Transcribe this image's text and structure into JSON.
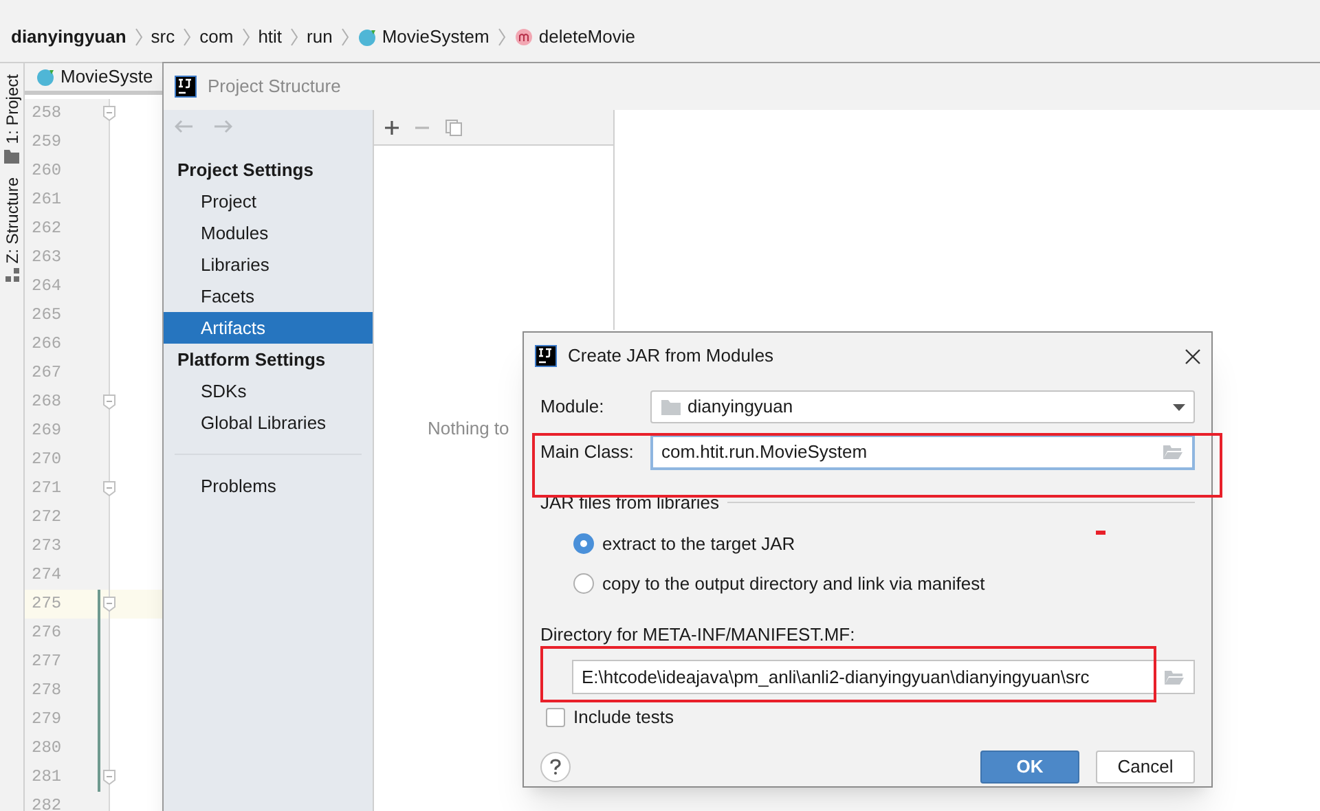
{
  "breadcrumbs": [
    {
      "label": "dianyingyuan",
      "kind": "project"
    },
    {
      "label": "src",
      "kind": "folder"
    },
    {
      "label": "com",
      "kind": "folder"
    },
    {
      "label": "htit",
      "kind": "folder"
    },
    {
      "label": "run",
      "kind": "folder"
    },
    {
      "label": "MovieSystem",
      "kind": "class"
    },
    {
      "label": "deleteMovie",
      "kind": "method"
    }
  ],
  "tool_strip": [
    {
      "label": "1: Project",
      "kind": "project"
    },
    {
      "label": "Z: Structure",
      "kind": "structure"
    }
  ],
  "editor": {
    "tab": "MovieSyste",
    "lines": [
      {
        "number": "258",
        "fold": true,
        "current": false,
        "changed": false
      },
      {
        "number": "259",
        "fold": false,
        "current": false,
        "changed": false
      },
      {
        "number": "260",
        "fold": false,
        "current": false,
        "changed": false
      },
      {
        "number": "261",
        "fold": false,
        "current": false,
        "changed": false
      },
      {
        "number": "262",
        "fold": false,
        "current": false,
        "changed": false
      },
      {
        "number": "263",
        "fold": false,
        "current": false,
        "changed": false
      },
      {
        "number": "264",
        "fold": false,
        "current": false,
        "changed": false
      },
      {
        "number": "265",
        "fold": false,
        "current": false,
        "changed": false
      },
      {
        "number": "266",
        "fold": false,
        "current": false,
        "changed": false
      },
      {
        "number": "267",
        "fold": false,
        "current": false,
        "changed": false
      },
      {
        "number": "268",
        "fold": true,
        "current": false,
        "changed": false
      },
      {
        "number": "269",
        "fold": false,
        "current": false,
        "changed": false
      },
      {
        "number": "270",
        "fold": false,
        "current": false,
        "changed": false
      },
      {
        "number": "271",
        "fold": true,
        "current": false,
        "changed": false
      },
      {
        "number": "272",
        "fold": false,
        "current": false,
        "changed": false
      },
      {
        "number": "273",
        "fold": false,
        "current": false,
        "changed": false
      },
      {
        "number": "274",
        "fold": false,
        "current": false,
        "changed": false
      },
      {
        "number": "275",
        "fold": true,
        "current": true,
        "changed": true
      },
      {
        "number": "276",
        "fold": false,
        "current": false,
        "changed": true
      },
      {
        "number": "277",
        "fold": false,
        "current": false,
        "changed": true
      },
      {
        "number": "278",
        "fold": false,
        "current": false,
        "changed": true
      },
      {
        "number": "279",
        "fold": false,
        "current": false,
        "changed": true
      },
      {
        "number": "280",
        "fold": false,
        "current": false,
        "changed": true
      },
      {
        "number": "281",
        "fold": true,
        "current": false,
        "changed": true
      },
      {
        "number": "282",
        "fold": false,
        "current": false,
        "changed": false
      }
    ]
  },
  "project_structure": {
    "title": "Project Structure",
    "sections": [
      {
        "title": "Project Settings",
        "items": [
          {
            "label": "Project",
            "selected": false
          },
          {
            "label": "Modules",
            "selected": false
          },
          {
            "label": "Libraries",
            "selected": false
          },
          {
            "label": "Facets",
            "selected": false
          },
          {
            "label": "Artifacts",
            "selected": true
          }
        ]
      },
      {
        "title": "Platform Settings",
        "items": [
          {
            "label": "SDKs",
            "selected": false
          },
          {
            "label": "Global Libraries",
            "selected": false
          }
        ]
      }
    ],
    "problems": {
      "label": "Problems",
      "selected": false
    },
    "empty_text": "Nothing to"
  },
  "jar_dialog": {
    "title": "Create JAR from Modules",
    "module_label": "Module:",
    "module_value": "dianyingyuan",
    "main_class_label": "Main Class:",
    "main_class_value": "com.htit.run.MovieSystem",
    "libraries_heading": "JAR files from libraries",
    "library_options": [
      {
        "label": "extract to the target JAR",
        "selected": true
      },
      {
        "label": "copy to the output directory and link via manifest",
        "selected": false
      }
    ],
    "manifest_label": "Directory for META-INF/MANIFEST.MF:",
    "manifest_value": "E:\\htcode\\ideajava\\pm_anli\\anli2-dianyingyuan\\dianyingyuan\\src",
    "include_tests": {
      "label": "Include tests",
      "checked": false
    },
    "buttons": [
      {
        "label": "OK",
        "kind": "primary"
      },
      {
        "label": "Cancel",
        "kind": "secondary"
      }
    ]
  }
}
